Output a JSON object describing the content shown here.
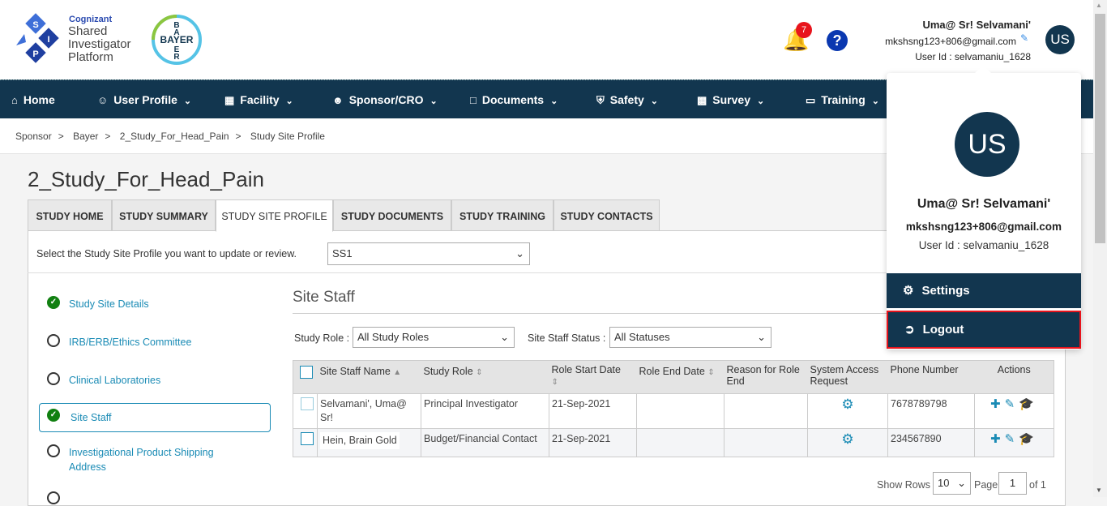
{
  "header": {
    "brand_company": "Cognizant",
    "brand_line1": "Shared",
    "brand_line2": "Investigator",
    "brand_line3": "Platform",
    "logo_letters": [
      "S",
      "I",
      "P"
    ],
    "sponsor_logo": "BAYER",
    "notification_count": "7",
    "user_name": "Uma@ Sr! Selvamani'",
    "user_email": "mkshsng123+806@gmail.com",
    "user_id": "User Id : selvamaniu_1628",
    "avatar_initials": "US"
  },
  "nav": {
    "items": [
      {
        "label": "Home",
        "icon": "home-icon"
      },
      {
        "label": "User Profile",
        "icon": "user-circle-icon"
      },
      {
        "label": "Facility",
        "icon": "building-icon"
      },
      {
        "label": "Sponsor/CRO",
        "icon": "users-icon"
      },
      {
        "label": "Documents",
        "icon": "file-icon"
      },
      {
        "label": "Safety",
        "icon": "shield-icon"
      },
      {
        "label": "Survey",
        "icon": "bar-chart-icon"
      },
      {
        "label": "Training",
        "icon": "laptop-icon"
      }
    ]
  },
  "breadcrumb": [
    "Sponsor",
    "Bayer",
    "2_Study_For_Head_Pain",
    "Study Site Profile"
  ],
  "page_title": "2_Study_For_Head_Pain",
  "tabs": [
    "STUDY HOME",
    "STUDY SUMMARY",
    "STUDY SITE PROFILE",
    "STUDY DOCUMENTS",
    "STUDY TRAINING",
    "STUDY CONTACTS"
  ],
  "active_tab": "STUDY SITE PROFILE",
  "site_select": {
    "label": "Select the Study Site Profile you want to update or review.",
    "value": "SS1"
  },
  "side_menu": [
    {
      "label": "Study Site Details",
      "done": true
    },
    {
      "label": "IRB/ERB/Ethics Committee",
      "done": false
    },
    {
      "label": "Clinical Laboratories",
      "done": false
    },
    {
      "label": "Site Staff",
      "done": true,
      "active": true
    },
    {
      "label": "Investigational Product Shipping Address",
      "done": false
    }
  ],
  "section": {
    "title": "Site Staff",
    "role_label": "Study Role :",
    "role_value": "All Study Roles",
    "status_label": "Site Staff Status :",
    "status_value": "All Statuses"
  },
  "table": {
    "headers": [
      "Site Staff Name",
      "Study Role",
      "Role Start Date",
      "Role End Date",
      "Reason for Role End",
      "System Access Request",
      "Phone Number",
      "Actions"
    ],
    "rows": [
      {
        "name": "Selvamani', Uma@ Sr!",
        "role": "Principal Investigator",
        "start": "21-Sep-2021",
        "end": "",
        "reason": "",
        "phone": "7678789798"
      },
      {
        "name": "Hein, Brain Gold",
        "role": "Budget/Financial Contact",
        "start": "21-Sep-2021",
        "end": "",
        "reason": "",
        "phone": "234567890"
      }
    ]
  },
  "pagination": {
    "show_rows_label": "Show Rows",
    "rows_value": "10",
    "page_label": "Page",
    "page_value": "1",
    "of_label": "of 1"
  },
  "user_menu": {
    "initials": "US",
    "name": "Uma@ Sr! Selvamani'",
    "email": "mkshsng123+806@gmail.com",
    "user_id": "User Id : selvamaniu_1628",
    "settings": "Settings",
    "logout": "Logout"
  },
  "colors": {
    "nav": "#12364f",
    "accent": "#1a8bb5",
    "success": "#118011",
    "badge": "#e8141c",
    "highlight_border": "#e8141c"
  }
}
